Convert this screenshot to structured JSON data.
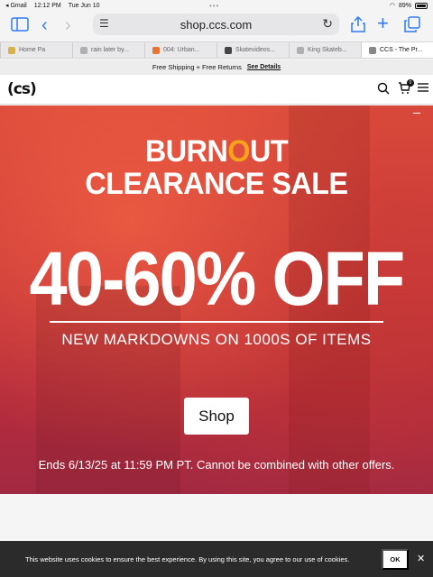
{
  "status_bar": {
    "back_app": "◂ Gmail",
    "time": "12:12 PM",
    "date": "Tue Jun 10",
    "battery": "89%"
  },
  "browser": {
    "url": "shop.ccs.com",
    "tabs": [
      {
        "label": "Home Pa",
        "color": "#d9b24c"
      },
      {
        "label": "rain later by...",
        "color": "#b0b0b0"
      },
      {
        "label": "004: Urban...",
        "color": "#e8732f"
      },
      {
        "label": "Skatevideos...",
        "color": "#444444"
      },
      {
        "label": "King Skateb...",
        "color": "#b0b0b0"
      },
      {
        "label": "CCS - The Pr...",
        "color": "#888888"
      }
    ]
  },
  "promo": {
    "text": "Free Shipping + Free Returns",
    "link": "See Details"
  },
  "header": {
    "logo": "(cs)",
    "cart_count": "0"
  },
  "hero": {
    "headline_prefix": "BURN",
    "headline_flame": "O",
    "headline_suffix": "UT",
    "headline_2": "CLEARANCE SALE",
    "discount": "40-60% OFF",
    "subline": "NEW MARKDOWNS ON 1000S OF ITEMS",
    "shop_label": "Shop",
    "ends": "Ends 6/13/25 at 11:59 PM PT. Cannot be combined with other offers."
  },
  "cookie": {
    "message": "This website uses cookies to ensure the best experience. By using this site, you agree to our use of cookies.",
    "ok_label": "OK",
    "close_label": "✕"
  },
  "colors": {
    "hero_red": "#c9383a",
    "accent_blue": "#2f7bf5",
    "flame_orange": "#f7a21b"
  }
}
